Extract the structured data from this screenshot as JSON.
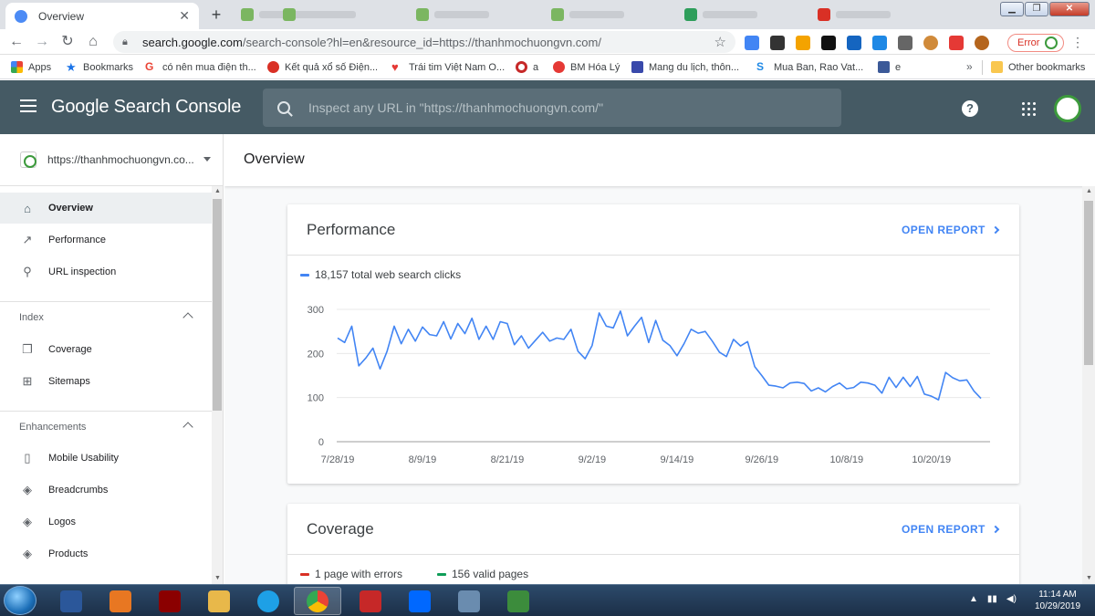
{
  "browser": {
    "active_tab_title": "Overview",
    "url_host": "search.google.com",
    "url_path": "/search-console?hl=en&resource_id=https://thanhmochuongvn.com/",
    "error_label": "Error"
  },
  "bookmarks": [
    {
      "label": "Apps",
      "icon": "apps-grid-icon",
      "color": "#4285f4"
    },
    {
      "label": "Bookmarks",
      "icon": "star-icon",
      "color": "#1a73e8"
    },
    {
      "label": "có nên mua điện th...",
      "icon": "google-g-icon",
      "color": "#ea4335"
    },
    {
      "label": "Kết quả xổ số Điện...",
      "icon": "lottery-icon",
      "color": "#d93025"
    },
    {
      "label": "Trái tim Việt Nam O...",
      "icon": "heart-icon",
      "color": "#e53935"
    },
    {
      "label": "a",
      "icon": "target-icon",
      "color": "#c62828"
    },
    {
      "label": "BM Hóa Lý",
      "icon": "bm-icon",
      "color": "#e53935"
    },
    {
      "label": "Mang du lịch, thôn...",
      "icon": "travel-icon",
      "color": "#3949ab"
    },
    {
      "label": "Mua Ban, Rao Vat...",
      "icon": "muaban-icon",
      "color": "#1e88e5"
    },
    {
      "label": "e",
      "icon": "facebook-icon",
      "color": "#3b5998"
    }
  ],
  "bookmarks_overflow": "»",
  "other_bookmarks": "Other bookmarks",
  "app": {
    "brand": "Google Search Console",
    "search_placeholder": "Inspect any URL in \"https://thanhmochuongvn.com/\"",
    "help_label": "?"
  },
  "sidebar": {
    "property": "https://thanhmochuongvn.co...",
    "items": [
      {
        "label": "Overview",
        "icon": "home-icon",
        "glyph": "⌂",
        "active": true
      },
      {
        "label": "Performance",
        "icon": "trending-up-icon",
        "glyph": "↗",
        "active": false
      },
      {
        "label": "URL inspection",
        "icon": "search-icon",
        "glyph": "⚲",
        "active": false
      }
    ],
    "sections": [
      {
        "label": "Index",
        "items": [
          {
            "label": "Coverage",
            "icon": "coverage-icon",
            "glyph": "❐"
          },
          {
            "label": "Sitemaps",
            "icon": "sitemap-icon",
            "glyph": "⊞"
          }
        ]
      },
      {
        "label": "Enhancements",
        "items": [
          {
            "label": "Mobile Usability",
            "icon": "phone-icon",
            "glyph": "▯"
          },
          {
            "label": "Breadcrumbs",
            "icon": "layers-icon",
            "glyph": "◈"
          },
          {
            "label": "Logos",
            "icon": "layers-icon",
            "glyph": "◈"
          },
          {
            "label": "Products",
            "icon": "layers-icon",
            "glyph": "◈"
          }
        ]
      }
    ]
  },
  "page": {
    "title": "Overview"
  },
  "performance": {
    "title": "Performance",
    "open_label": "OPEN REPORT",
    "legend": "18,157 total web search clicks",
    "color": "#4285f4"
  },
  "coverage": {
    "title": "Coverage",
    "open_label": "OPEN REPORT",
    "legend_errors": "1 page with errors",
    "legend_valid": "156 valid pages",
    "errors_color": "#d93025",
    "valid_color": "#0f9d58"
  },
  "chart_data": {
    "type": "line",
    "title": "",
    "xlabel": "",
    "ylabel": "",
    "ylim": [
      0,
      300
    ],
    "yticks": [
      0,
      100,
      200,
      300
    ],
    "x_tick_labels": [
      "7/28/19",
      "8/9/19",
      "8/21/19",
      "9/2/19",
      "9/14/19",
      "9/26/19",
      "10/8/19",
      "10/20/19"
    ],
    "x_tick_index": [
      0,
      12,
      24,
      36,
      48,
      60,
      72,
      84
    ],
    "grid": true,
    "series": [
      {
        "name": "",
        "values": [
          235,
          225,
          262,
          172,
          190,
          212,
          165,
          205,
          262,
          222,
          255,
          228,
          260,
          243,
          240,
          272,
          233,
          268,
          245,
          280,
          232,
          262,
          232,
          272,
          268,
          220,
          240,
          212,
          230,
          248,
          228,
          235,
          232,
          255,
          205,
          188,
          218,
          292,
          262,
          258,
          296,
          240,
          262,
          282,
          225,
          275,
          230,
          218,
          195,
          222,
          255,
          246,
          250,
          228,
          203,
          193,
          232,
          217,
          227,
          170,
          150,
          128,
          126,
          122,
          133,
          135,
          132,
          115,
          122,
          113,
          125,
          133,
          120,
          123,
          135,
          133,
          128,
          110,
          146,
          123,
          146,
          125,
          148,
          108,
          103,
          95,
          157,
          145,
          138,
          140,
          115,
          98
        ]
      }
    ]
  },
  "taskbar": {
    "time": "11:14 AM",
    "date": "10/29/2019"
  }
}
